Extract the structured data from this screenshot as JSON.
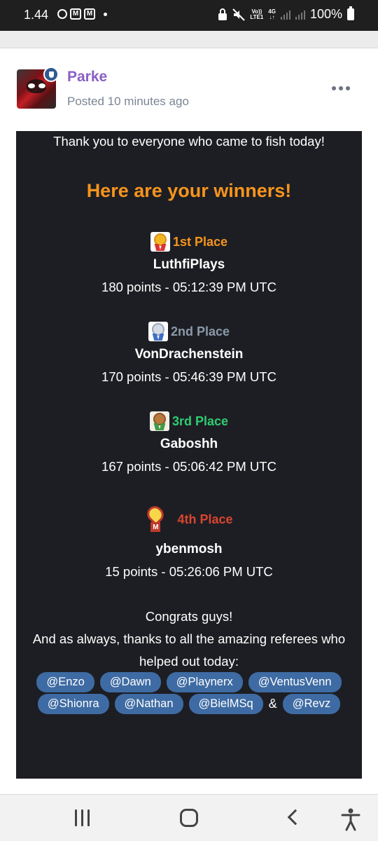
{
  "status_bar": {
    "time": "1.44",
    "battery": "100%",
    "volte_top": "Vo))",
    "volte_bottom": "LTE1",
    "net_type": "4G"
  },
  "post": {
    "author": "Parke",
    "posted": "Posted 10 minutes ago",
    "intro": "Thank you to everyone who came to fish today!",
    "headline": "Here are your winners!",
    "winners": [
      {
        "place": "1st Place",
        "name": "LuthfiPlays",
        "score": "180 points -  05:12:39 PM UTC",
        "color": "#f7941d"
      },
      {
        "place": "2nd Place",
        "name": "VonDrachenstein",
        "score": "170 points -   05:46:39 PM UTC",
        "color": "#8b99a8"
      },
      {
        "place": "3rd Place",
        "name": "Gaboshh",
        "score": "167 points -  05:06:42 PM UTC",
        "color": "#2ecc71"
      },
      {
        "place": "4th Place",
        "name": "ybenmosh",
        "score": "15 points -  05:26:06 PM UTC",
        "color": "#d9452f"
      }
    ],
    "outro_1": "Congrats guys!",
    "outro_2": "And as always, thanks to all the amazing referees who",
    "outro_3": "helped out today:",
    "mentions_row1": [
      "@Enzo",
      "@Dawn",
      "@Playnerx",
      "@VentusVenn"
    ],
    "mentions_row2": [
      "@Shionra",
      "@Nathan",
      "@BielMSq"
    ],
    "amp": "&",
    "mention_last": "@Revz",
    "heart_medal_letter": "M"
  },
  "icons": {
    "more": "more-options-icon",
    "recents": "recents-icon",
    "home": "home-icon",
    "back": "back-icon",
    "accessibility": "accessibility-icon"
  }
}
